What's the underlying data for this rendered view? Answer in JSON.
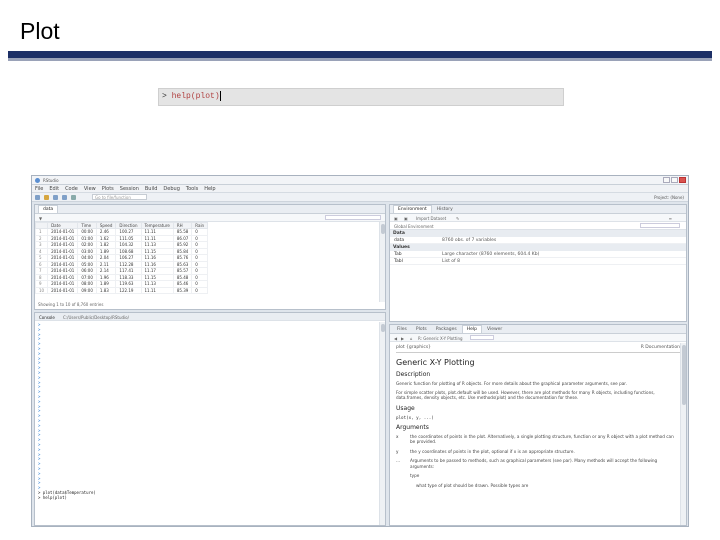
{
  "slide": {
    "title": "Plot"
  },
  "command": {
    "prompt": "> ",
    "code": "help(plot)"
  },
  "rstudio": {
    "title": "RStudio",
    "menu": [
      "File",
      "Edit",
      "Code",
      "View",
      "Plots",
      "Session",
      "Build",
      "Debug",
      "Tools",
      "Help"
    ],
    "goto_placeholder": "Go to file/function",
    "project": "Project: (None)",
    "data_viewer": {
      "tab": "data",
      "filter_label": "Q",
      "columns": [
        "",
        "Date",
        "Time",
        "Speed",
        "Direction",
        "Temperature",
        "RH",
        "Rain"
      ],
      "rows": [
        [
          "1",
          "2014-01-01",
          "00:00",
          "2.46",
          "100.27",
          "11.11",
          "85.58",
          "0"
        ],
        [
          "2",
          "2014-01-01",
          "01:00",
          "1.62",
          "111.05",
          "11.11",
          "86.07",
          "0"
        ],
        [
          "3",
          "2014-01-01",
          "02:00",
          "1.82",
          "104.32",
          "11.13",
          "85.92",
          "0"
        ],
        [
          "4",
          "2014-01-01",
          "03:00",
          "1.89",
          "108.68",
          "11.15",
          "85.84",
          "0"
        ],
        [
          "5",
          "2014-01-01",
          "04:00",
          "2.04",
          "106.27",
          "11.16",
          "85.76",
          "0"
        ],
        [
          "6",
          "2014-01-01",
          "05:00",
          "2.11",
          "112.28",
          "11.16",
          "85.63",
          "0"
        ],
        [
          "7",
          "2014-01-01",
          "06:00",
          "2.14",
          "117.41",
          "11.17",
          "85.57",
          "0"
        ],
        [
          "8",
          "2014-01-01",
          "07:00",
          "1.96",
          "118.33",
          "11.15",
          "85.48",
          "0"
        ],
        [
          "9",
          "2014-01-01",
          "08:00",
          "1.89",
          "119.63",
          "11.13",
          "85.46",
          "0"
        ],
        [
          "10",
          "2014-01-01",
          "09:00",
          "1.83",
          "122.19",
          "11.11",
          "85.39",
          "0"
        ]
      ],
      "footer": "Showing 1 to 10 of 8,760 entries"
    },
    "console": {
      "tab": "Console",
      "path": "C:/Users/Public/Desktop/RStudio/",
      "prompts": 35,
      "commands": [
        "> plot(data$Temperature)",
        "> help(plot)"
      ]
    },
    "environment": {
      "tabs": [
        "Environment",
        "History"
      ],
      "toolbar": "Import Dataset",
      "scope": "Global Environment",
      "data_header": "Data",
      "data_rows": [
        {
          "name": "data",
          "value": "8760 obs. of 7 variables"
        }
      ],
      "values_header": "Values",
      "value_rows": [
        {
          "name": "Tab",
          "value": "Large character (8760 elements, 604.4 Kb)"
        },
        {
          "name": "Tabl",
          "value": "List of 8"
        }
      ]
    },
    "help": {
      "tabs": [
        "Files",
        "Plots",
        "Packages",
        "Help",
        "Viewer"
      ],
      "topic": "R: Generic X-Y Plotting",
      "page_header_left": "plot {graphics}",
      "page_header_right": "R Documentation",
      "h1": "Generic X-Y Plotting",
      "description_h": "Description",
      "description": "Generic function for plotting of R objects. For more details about the graphical parameter arguments, see par.",
      "description2": "For simple scatter plots, plot.default will be used. However, there are plot methods for many R objects, including functions, data.frames, density objects, etc. Use methods(plot) and the documentation for these.",
      "usage_h": "Usage",
      "usage": "plot(x, y, ...)",
      "arguments_h": "Arguments",
      "args": [
        {
          "k": "x",
          "v": "the coordinates of points in the plot. Alternatively, a single plotting structure, function or any R object with a plot method can be provided."
        },
        {
          "k": "y",
          "v": "the y coordinates of points in the plot, optional if x is an appropriate structure."
        },
        {
          "k": "...",
          "v": "Arguments to be passed to methods, such as graphical parameters (see par). Many methods will accept the following arguments:"
        }
      ],
      "type_label": "type",
      "type_desc": "what type of plot should be drawn. Possible types are"
    }
  }
}
